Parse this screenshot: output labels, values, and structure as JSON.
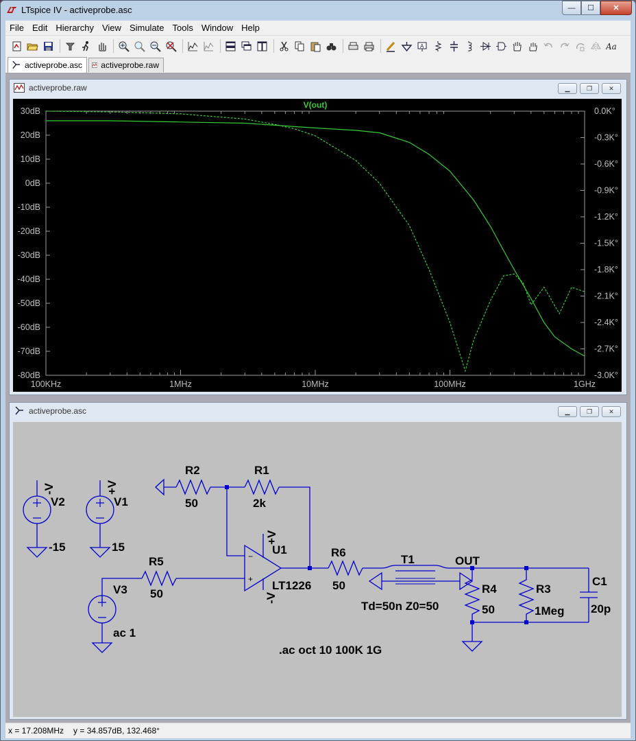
{
  "window": {
    "title": "LTspice IV - activeprobe.asc",
    "minimize": "—",
    "maximize": "☐",
    "close": "✕"
  },
  "menu": [
    "File",
    "Edit",
    "Hierarchy",
    "View",
    "Simulate",
    "Tools",
    "Window",
    "Help"
  ],
  "toolbar_icons": [
    "new-schematic-icon",
    "open-icon",
    "save-icon",
    "control-panel-icon",
    "run-icon",
    "halt-icon",
    "zoom-in-icon",
    "zoom-area-icon",
    "zoom-out-icon",
    "zoom-cancel-icon",
    "autorange-icon",
    "manual-limits-icon",
    "tile-horizontal-icon",
    "cascade-icon",
    "tile-vertical-icon",
    "cut-icon",
    "copy-icon",
    "paste-icon",
    "find-icon",
    "print-setup-icon",
    "print-icon",
    "wire-icon",
    "ground-icon",
    "label-icon",
    "resistor-icon",
    "capacitor-icon",
    "inductor-icon",
    "diode-icon",
    "component-icon",
    "move-icon",
    "drag-icon",
    "undo-icon",
    "redo-icon",
    "rotate-icon",
    "mirror-icon",
    "text-icon"
  ],
  "tabs": [
    {
      "label": "activeprobe.asc",
      "icon": "schematic-icon",
      "active": true
    },
    {
      "label": "activeprobe.raw",
      "icon": "waveform-icon",
      "active": false
    }
  ],
  "plot_window": {
    "title": "activeprobe.raw",
    "trace_label": "V(out)",
    "trace_color": "#33cc33"
  },
  "chart_data": {
    "type": "line",
    "title": "V(out)",
    "x_scale": "log",
    "x_ticks": [
      "100KHz",
      "1MHz",
      "10MHz",
      "100MHz",
      "1GHz"
    ],
    "xlim_hz": [
      100000,
      1000000000
    ],
    "left_ticks": [
      "30dB",
      "20dB",
      "10dB",
      "0dB",
      "-10dB",
      "-20dB",
      "-30dB",
      "-40dB",
      "-50dB",
      "-60dB",
      "-70dB",
      "-80dB"
    ],
    "ylim_db": [
      -80,
      30
    ],
    "right_ticks": [
      "0.0K°",
      "-0.3K°",
      "-0.6K°",
      "-0.9K°",
      "-1.2K°",
      "-1.5K°",
      "-1.8K°",
      "-2.1K°",
      "-2.4K°",
      "-2.7K°",
      "-3.0K°"
    ],
    "ylim_phase_deg": [
      -3000,
      0
    ],
    "grid": false,
    "series": [
      {
        "style": "solid",
        "axis": "left",
        "x": [
          100000,
          300000,
          1000000,
          3000000,
          10000000,
          20000000,
          30000000,
          50000000,
          70000000,
          100000000,
          150000000,
          200000000,
          250000000,
          300000000,
          400000000,
          500000000,
          600000000,
          800000000,
          1000000000
        ],
        "y": [
          26,
          26,
          25.5,
          25,
          23,
          22,
          21,
          17,
          12,
          5,
          -7,
          -18,
          -28,
          -36,
          -48,
          -58,
          -64,
          -69,
          -72
        ]
      },
      {
        "style": "dashed",
        "axis": "right",
        "x": [
          100000,
          300000,
          1000000,
          3000000,
          5000000,
          7000000,
          10000000,
          20000000,
          30000000,
          50000000,
          70000000,
          100000000,
          130000000,
          150000000,
          200000000,
          250000000,
          300000000,
          350000000,
          400000000,
          500000000,
          650000000,
          800000000,
          1000000000
        ],
        "y": [
          0,
          -8,
          -30,
          -90,
          -150,
          -200,
          -280,
          -560,
          -820,
          -1300,
          -1800,
          -2400,
          -2950,
          -2600,
          -2150,
          -1870,
          -1850,
          -1950,
          -2200,
          -2000,
          -2300,
          -2000,
          -2050
        ]
      }
    ]
  },
  "schematic_window": {
    "title": "activeprobe.asc",
    "labels": {
      "v2_pin": "-V",
      "v2_name": "V2",
      "v2_value": "-15",
      "v1_pin": "+V",
      "v1_name": "V1",
      "v1_value": "15",
      "r2_name": "R2",
      "r2_value": "50",
      "r1_name": "R1",
      "r1_value": "2k",
      "u1_name": "U1",
      "u1_part": "LT1226",
      "u1_vplus": "+V",
      "u1_vminus": "-V",
      "u1_in_minus": "−",
      "u1_in_plus": "+",
      "r5_name": "R5",
      "r5_value": "50",
      "v3_name": "V3",
      "v3_value": "ac 1",
      "r6_name": "R6",
      "r6_value": "50",
      "t1_name": "T1",
      "t1_value": "Td=50n Z0=50",
      "out_label": "OUT",
      "r4_name": "R4",
      "r4_value": "50",
      "r3_name": "R3",
      "r3_value": "1Meg",
      "c1_name": "C1",
      "c1_value": "20p",
      "directive": ".ac oct 10 100K 1G"
    },
    "wire_color": "#0000d0"
  },
  "status": {
    "x": "x = 17.208MHz",
    "y": "y = 34.857dB, 132.468°"
  }
}
